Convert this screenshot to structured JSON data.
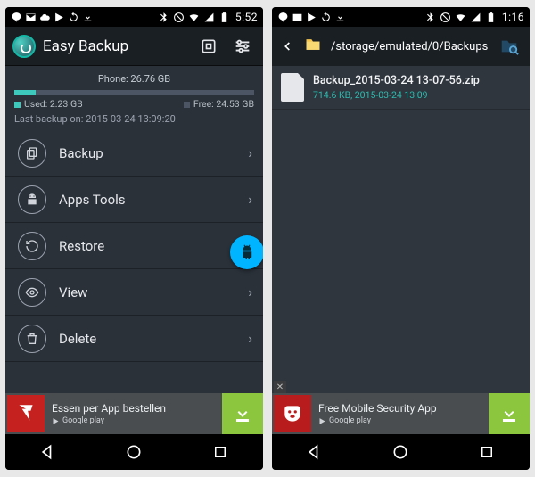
{
  "screenA": {
    "status": {
      "time": "5:52"
    },
    "actionbar": {
      "title": "Easy Backup"
    },
    "storage": {
      "title": "Phone: 26.76 GB",
      "used_label": "Used: 2.23 GB",
      "free_label": "Free: 24.53 GB",
      "last_backup": "Last backup on: 2015-03-24 13:09:20"
    },
    "menu": {
      "backup": "Backup",
      "apps": "Apps Tools",
      "restore": "Restore",
      "view": "View",
      "delete": "Delete"
    },
    "ad": {
      "text": "Essen per App bestellen",
      "store": "Google play"
    }
  },
  "screenB": {
    "status": {
      "time": "1:16"
    },
    "path": "/storage/emulated/0/Backups",
    "file": {
      "name": "Backup_2015-03-24 13-07-56.zip",
      "meta": "714.6 KB, 2015-03-24 13:09"
    },
    "ad": {
      "text": "Free Mobile Security App",
      "store": "Google play"
    }
  }
}
